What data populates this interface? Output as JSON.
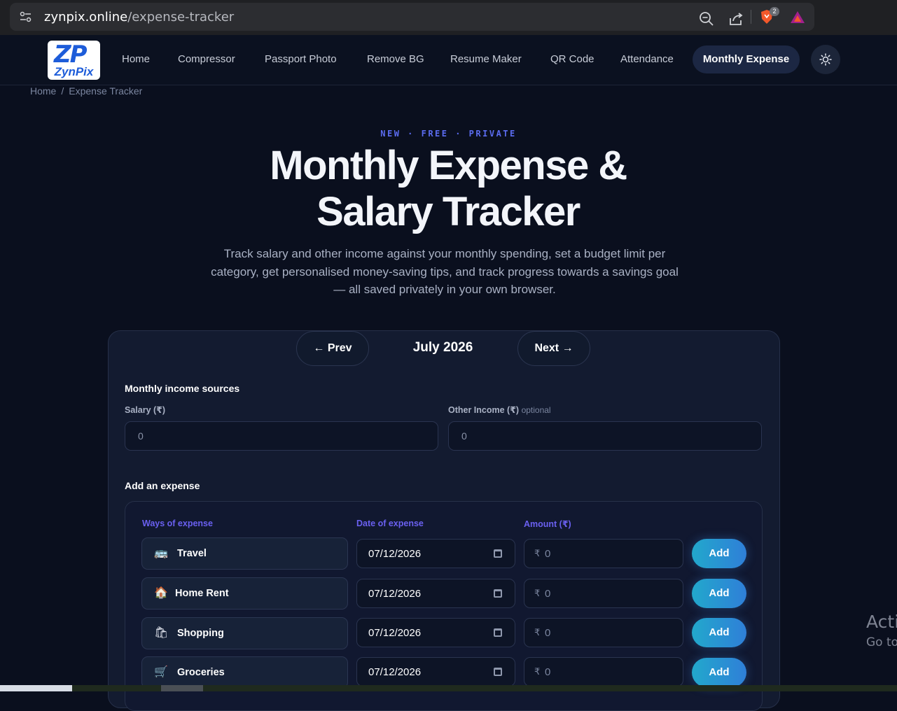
{
  "browser": {
    "url_host": "zynpix.online",
    "url_path": "/expense-tracker",
    "brave_badge": "2"
  },
  "nav": {
    "logo_mark": "ZP",
    "logo_name": "ZynPix",
    "links": [
      "Home",
      "Compressor",
      "Passport Photo",
      "Remove BG",
      "Resume Maker",
      "QR Code",
      "Attendance"
    ],
    "active": "Monthly Expense"
  },
  "breadcrumb": {
    "home": "Home",
    "separator": "/",
    "current": "Expense Tracker"
  },
  "hero": {
    "eyebrow": "NEW · FREE · PRIVATE",
    "title_line1": "Monthly Expense &",
    "title_line2": "Salary Tracker",
    "subtitle": "Track salary and other income against your monthly spending, set a budget limit per category, get personalised money-saving tips, and track progress towards a savings goal — all saved privately in your own browser."
  },
  "month_nav": {
    "prev_label": "← Prev",
    "current_month": "July 2026",
    "next_label": "Next →"
  },
  "income": {
    "section_title": "Monthly income sources",
    "salary_label": "Salary (₹)",
    "salary_value": "0",
    "other_label": "Other Income (₹)",
    "other_optional": "optional",
    "other_value": "0"
  },
  "expense": {
    "section_title": "Add an expense",
    "col_category": "Ways of expense",
    "col_date": "Date of expense",
    "col_amount": "Amount (₹)",
    "currency_symbol": "₹",
    "rows": [
      {
        "emoji": "🚌",
        "category": "Travel",
        "date": "07/12/2026",
        "amount": "0",
        "button": "Add"
      },
      {
        "emoji": "🏠",
        "category": "Home Rent",
        "date": "07/12/2026",
        "amount": "0",
        "button": "Add"
      },
      {
        "emoji": "🛍",
        "category": "Shopping",
        "date": "07/12/2026",
        "amount": "0",
        "button": "Add"
      },
      {
        "emoji": "🛒",
        "category": "Groceries",
        "date": "07/12/2026",
        "amount": "0",
        "button": "Add"
      }
    ]
  },
  "os_overlay": {
    "line1": "Acti",
    "line2": "Go to"
  },
  "colors": {
    "page_bg": "#0a0f1e",
    "card_bg": "#131b30",
    "accent": "#5b6cf0",
    "button_gradient_start": "#22a8cc",
    "button_gradient_end": "#2f7fd8"
  }
}
